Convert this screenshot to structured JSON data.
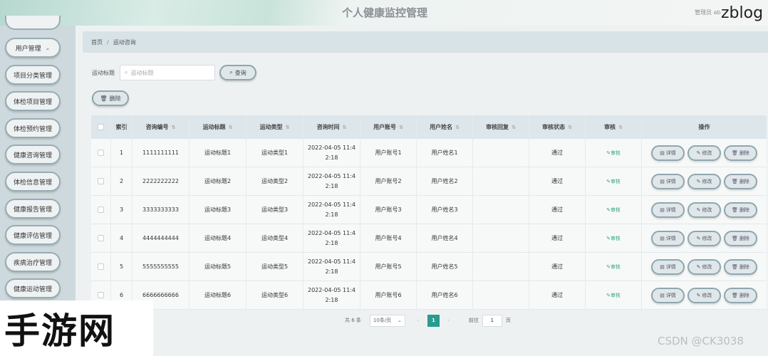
{
  "header": {
    "title": "个人健康监控管理",
    "admin": "管理员 ab",
    "watermark": "zblog"
  },
  "sidebar": {
    "items": [
      {
        "label": "用户管理",
        "chevron": "⌄"
      },
      {
        "label": "项目分类管理"
      },
      {
        "label": "体检项目管理"
      },
      {
        "label": "体检预约管理"
      },
      {
        "label": "健康咨询管理"
      },
      {
        "label": "体检信息管理"
      },
      {
        "label": "健康报告管理"
      },
      {
        "label": "健康评估管理"
      },
      {
        "label": "疾病治疗管理"
      },
      {
        "label": "健康运动管理"
      }
    ]
  },
  "breadcrumb": {
    "home": "首页",
    "separator": "/",
    "current": "运动咨询"
  },
  "search": {
    "label": "运动标题",
    "placeholder": "运动标题",
    "search_icon": "search-icon",
    "query_button": "查询",
    "delete_button": "删除"
  },
  "table": {
    "headers": [
      "索引",
      "咨询编号",
      "运动标题",
      "运动类型",
      "咨询时间",
      "用户账号",
      "用户姓名",
      "审核回复",
      "审核状态",
      "审核",
      "操作"
    ],
    "rows": [
      {
        "index": "1",
        "code": "1111111111",
        "title": "运动标题1",
        "type": "运动类型1",
        "time": "2022-04-05 11:4\n2:18",
        "account": "用户账号1",
        "name": "用户姓名1",
        "reply": "",
        "status": "通过",
        "audit": "审核"
      },
      {
        "index": "2",
        "code": "2222222222",
        "title": "运动标题2",
        "type": "运动类型2",
        "time": "2022-04-05 11:4\n2:18",
        "account": "用户账号2",
        "name": "用户姓名2",
        "reply": "",
        "status": "通过",
        "audit": "审核"
      },
      {
        "index": "3",
        "code": "3333333333",
        "title": "运动标题3",
        "type": "运动类型3",
        "time": "2022-04-05 11:4\n2:18",
        "account": "用户账号3",
        "name": "用户姓名3",
        "reply": "",
        "status": "通过",
        "audit": "审核"
      },
      {
        "index": "4",
        "code": "4444444444",
        "title": "运动标题4",
        "type": "运动类型4",
        "time": "2022-04-05 11:4\n2:18",
        "account": "用户账号4",
        "name": "用户姓名4",
        "reply": "",
        "status": "通过",
        "audit": "审核"
      },
      {
        "index": "5",
        "code": "5555555555",
        "title": "运动标题5",
        "type": "运动类型5",
        "time": "2022-04-05 11:4\n2:18",
        "account": "用户账号5",
        "name": "用户姓名5",
        "reply": "",
        "status": "通过",
        "audit": "审核"
      },
      {
        "index": "6",
        "code": "6666666666",
        "title": "运动标题6",
        "type": "运动类型6",
        "time": "2022-04-05 11:4\n2:18",
        "account": "用户账号6",
        "name": "用户姓名6",
        "reply": "",
        "status": "通过",
        "audit": "审核"
      }
    ],
    "actions": {
      "detail": "详情",
      "edit": "修改",
      "delete": "删除"
    }
  },
  "pagination": {
    "total": "共 6 条",
    "page_size": "10条/页",
    "current_page": "1",
    "goto_label": "前往",
    "goto_value": "1",
    "goto_unit": "页"
  },
  "watermarks": {
    "bottom_left": "手游网",
    "bottom_right": "CSDN @CK3038"
  },
  "colors": {
    "accent": "#2a9b8f",
    "audit_link": "#3aa57d",
    "sidebar_bg": "#cdd9dd"
  }
}
